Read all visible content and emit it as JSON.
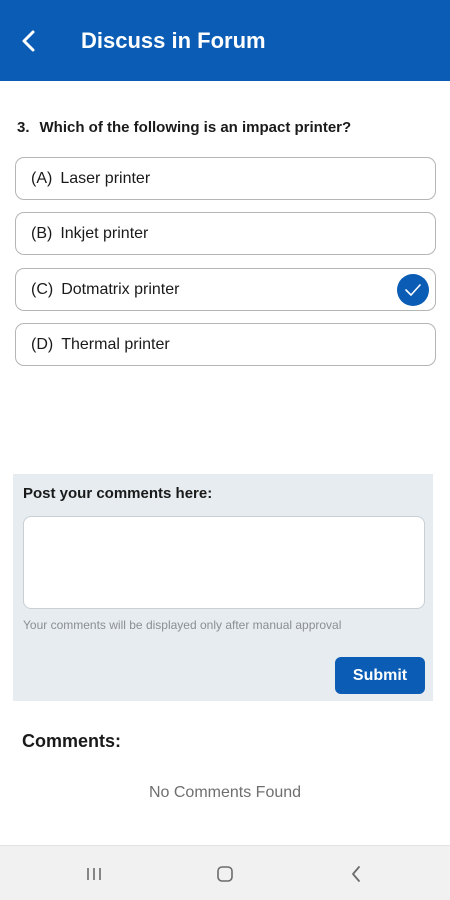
{
  "header": {
    "title": "Discuss in Forum",
    "back_icon": "chevron-left-icon"
  },
  "question": {
    "number": "3.",
    "text": "Which of the following is an impact printer?"
  },
  "options": [
    {
      "letter": "(A)",
      "label": "Laser printer",
      "selected": false
    },
    {
      "letter": "(B)",
      "label": "Inkjet printer",
      "selected": false
    },
    {
      "letter": "(C)",
      "label": "Dotmatrix printer",
      "selected": true
    },
    {
      "letter": "(D)",
      "label": "Thermal printer",
      "selected": false
    }
  ],
  "comment_form": {
    "label": "Post your comments here:",
    "value": "",
    "note": "Your comments will be displayed only after manual approval",
    "submit_label": "Submit"
  },
  "comments": {
    "heading": "Comments:",
    "empty_text": "No Comments Found"
  },
  "system_nav": {
    "icons": [
      "recent-apps-icon",
      "home-icon",
      "back-icon"
    ]
  },
  "colors": {
    "accent": "#0a5cb5",
    "panel_bg": "#e6ecef"
  }
}
